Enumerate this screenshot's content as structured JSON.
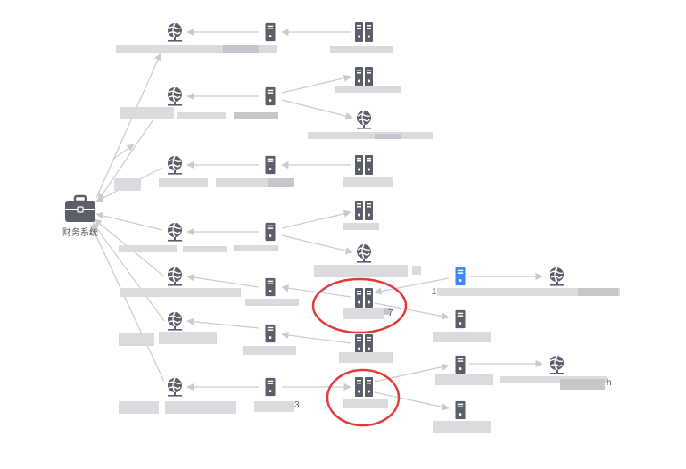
{
  "diagram": {
    "root_label": "财务系统",
    "label_fragments": {
      "f1": "7",
      "f2": "3",
      "f3": "1",
      "f4": "h"
    }
  },
  "colors": {
    "background": "#ffffff",
    "icon": "#5b5f69",
    "icon_highlight": "#3d8af7",
    "edge": "#c9cdd2",
    "circle_annotation": "#e23b3b",
    "redacted": "#d9dbde"
  },
  "icons": {
    "root": "briefcase-icon",
    "globe": "globe-network-icon",
    "server_single": "server-icon",
    "server_cluster": "server-cluster-icon"
  }
}
